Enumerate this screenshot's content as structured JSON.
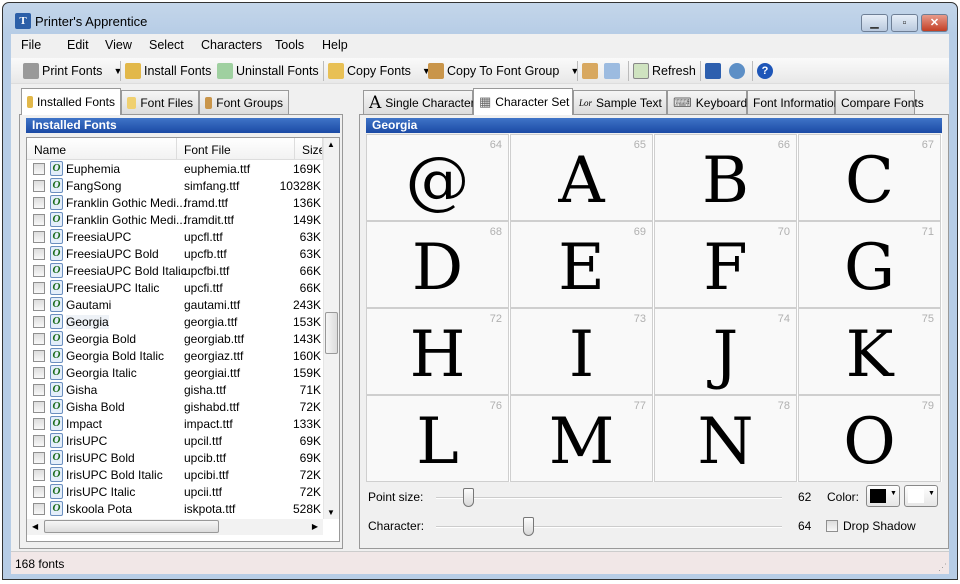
{
  "window": {
    "title": "Printer's Apprentice"
  },
  "menu": [
    "File",
    "Edit",
    "View",
    "Select",
    "Characters",
    "Tools",
    "Help"
  ],
  "toolbar": {
    "print_fonts": "Print Fonts",
    "install_fonts": "Install Fonts",
    "uninstall_fonts": "Uninstall Fonts",
    "copy_fonts": "Copy Fonts",
    "copy_to_group": "Copy To Font Group",
    "refresh": "Refresh"
  },
  "left": {
    "tabs": [
      "Installed Fonts",
      "Font Files",
      "Font Groups"
    ],
    "header": "Installed Fonts",
    "columns": [
      "Name",
      "Font File",
      "Size"
    ],
    "rows": [
      [
        "Euphemia",
        "euphemia.ttf",
        "169K"
      ],
      [
        "FangSong",
        "simfang.ttf",
        "10328K"
      ],
      [
        "Franklin Gothic Medi...",
        "framd.ttf",
        "136K"
      ],
      [
        "Franklin Gothic Medi...",
        "framdit.ttf",
        "149K"
      ],
      [
        "FreesiaUPC",
        "upcfl.ttf",
        "63K"
      ],
      [
        "FreesiaUPC Bold",
        "upcfb.ttf",
        "63K"
      ],
      [
        "FreesiaUPC Bold Italic",
        "upcfbi.ttf",
        "66K"
      ],
      [
        "FreesiaUPC Italic",
        "upcfi.ttf",
        "66K"
      ],
      [
        "Gautami",
        "gautami.ttf",
        "243K"
      ],
      [
        "Georgia",
        "georgia.ttf",
        "153K"
      ],
      [
        "Georgia Bold",
        "georgiab.ttf",
        "143K"
      ],
      [
        "Georgia Bold Italic",
        "georgiaz.ttf",
        "160K"
      ],
      [
        "Georgia Italic",
        "georgiai.ttf",
        "159K"
      ],
      [
        "Gisha",
        "gisha.ttf",
        "71K"
      ],
      [
        "Gisha Bold",
        "gishabd.ttf",
        "72K"
      ],
      [
        "Impact",
        "impact.ttf",
        "133K"
      ],
      [
        "IrisUPC",
        "upcil.ttf",
        "69K"
      ],
      [
        "IrisUPC Bold",
        "upcib.ttf",
        "69K"
      ],
      [
        "IrisUPC Bold Italic",
        "upcibi.ttf",
        "72K"
      ],
      [
        "IrisUPC Italic",
        "upcii.ttf",
        "72K"
      ],
      [
        "Iskoola Pota",
        "iskpota.ttf",
        "528K"
      ]
    ],
    "selected_index": 9
  },
  "right": {
    "tabs": [
      "Single Character",
      "Character Set",
      "Sample Text",
      "Keyboard",
      "Font Information",
      "Compare Fonts"
    ],
    "active_tab": 1,
    "header": "Georgia",
    "cells": [
      [
        "@",
        "64"
      ],
      [
        "A",
        "65"
      ],
      [
        "B",
        "66"
      ],
      [
        "C",
        "67"
      ],
      [
        "D",
        "68"
      ],
      [
        "E",
        "69"
      ],
      [
        "F",
        "70"
      ],
      [
        "G",
        "71"
      ],
      [
        "H",
        "72"
      ],
      [
        "I",
        "73"
      ],
      [
        "J",
        "74"
      ],
      [
        "K",
        "75"
      ],
      [
        "L",
        "76"
      ],
      [
        "M",
        "77"
      ],
      [
        "N",
        "78"
      ],
      [
        "O",
        "79"
      ]
    ],
    "point_size_label": "Point size:",
    "point_size": "62",
    "character_label": "Character:",
    "character": "64",
    "color_label": "Color:",
    "drop_shadow": "Drop Shadow",
    "point_size_fraction": 0.08,
    "character_fraction": 0.26,
    "fg_color": "#000000",
    "bg_color": "#ffffff"
  },
  "status": "168 fonts"
}
